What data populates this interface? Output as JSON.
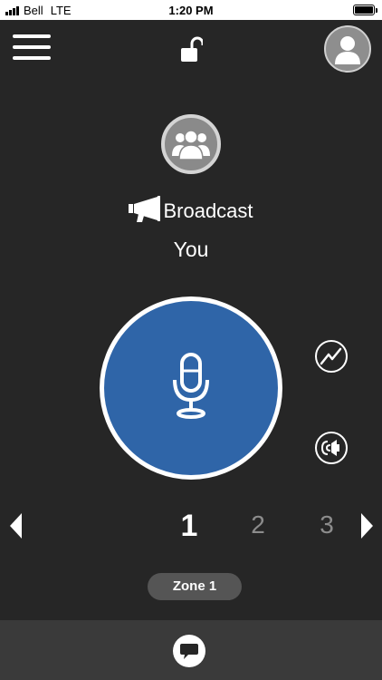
{
  "status_bar": {
    "carrier": "Bell",
    "network": "LTE",
    "time": "1:20 PM",
    "battery_level": 1.0
  },
  "header": {
    "menu_icon": "hamburger-menu-icon",
    "lock_icon": "unlocked-padlock-icon",
    "avatar_icon": "user-avatar-icon"
  },
  "talkgroup": {
    "group_icon": "group-avatar-icon",
    "mode_icon": "megaphone-icon",
    "mode_label": "Broadcast",
    "speaker_label": "You"
  },
  "ptt": {
    "icon": "microphone-icon",
    "color": "#2f65a8"
  },
  "side_actions": {
    "activity_icon": "activity-icon",
    "speaker_icon": "speaker-icon"
  },
  "channels": {
    "items": [
      "1",
      "2",
      "3"
    ],
    "selected": "1",
    "prev_icon": "arrow-left-icon",
    "next_icon": "arrow-right-icon"
  },
  "zone": {
    "label": "Zone 1"
  },
  "bottom_bar": {
    "chat_icon": "chat-bubble-icon"
  }
}
